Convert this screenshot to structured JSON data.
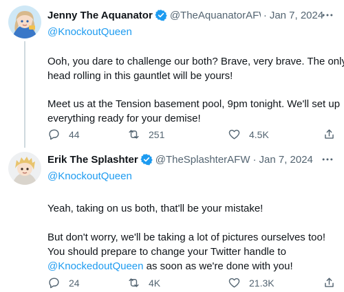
{
  "tweets": [
    {
      "name": "Jenny The Aquanator",
      "handle": "@TheAquanatorAFW",
      "date": "Jan 7, 2024",
      "reply_to": "@KnockoutQueen",
      "lines": [
        "Ooh, you dare to challenge our both? Brave, very brave. The only",
        "head rolling in this gauntlet will be yours!",
        "Meet us at the Tension basement pool, 9pm tonight. We'll set up",
        "everything ready for your demise!"
      ],
      "replies": "44",
      "retweets": "251",
      "likes": "4.5K"
    },
    {
      "name": "Erik The Splashter",
      "handle": "@TheSplashterAFW",
      "date": "Jan 7, 2024",
      "reply_to": "@KnockoutQueen",
      "lines": [
        "Yeah, taking on us both, that'll be your mistake!",
        "But don't worry, we'll be taking a lot of pictures ourselves too!",
        "You should prepare to change your Twitter handle to",
        "as soon as we're done with you!"
      ],
      "mention_inline": "@KnockedoutQueen",
      "replies": "24",
      "retweets": "4K",
      "likes": "21.3K"
    }
  ],
  "separator": "·",
  "colors": {
    "accent": "#1d9bf0",
    "muted": "#536471",
    "text": "#0f1419",
    "thread": "#cfd9de"
  },
  "icons": [
    "verified-badge-icon",
    "more-icon",
    "reply-icon",
    "retweet-icon",
    "like-icon",
    "share-icon"
  ]
}
